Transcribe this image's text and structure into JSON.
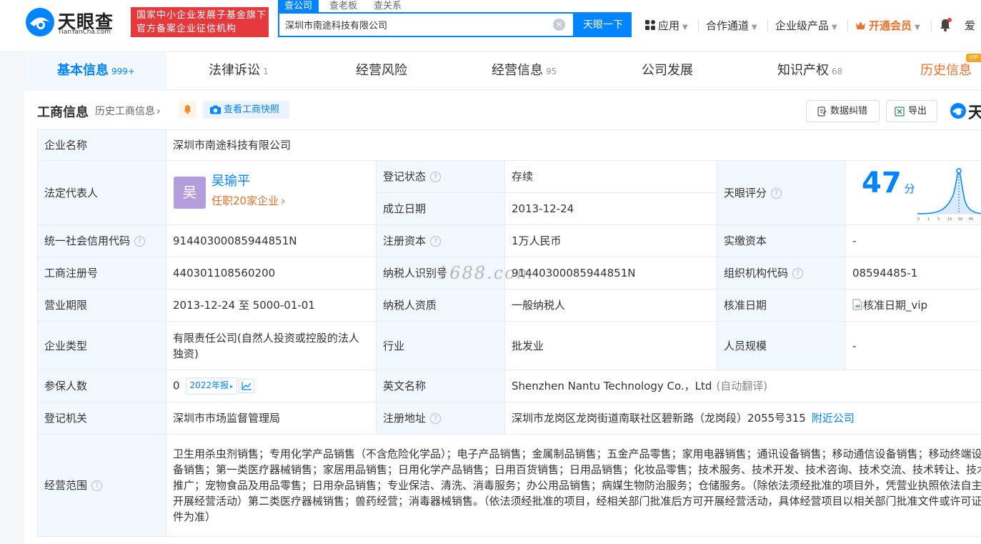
{
  "header": {
    "logo_cn": "天眼查",
    "logo_en": "TianYanCha.com",
    "banner_line1": "国家中小企业发展子基金旗下",
    "banner_line2": "官方备案企业征信机构",
    "search_tabs": [
      "查公司",
      "查老板",
      "查关系"
    ],
    "search_value": "深圳市南途科技有限公司",
    "search_button": "天眼一下",
    "nav": {
      "apps": "应用",
      "cooperation": "合作通道",
      "enterprise": "企业级产品",
      "vip": "开通会员",
      "user": "爱"
    }
  },
  "tabs": [
    {
      "label": "基本信息",
      "count": "999+"
    },
    {
      "label": "法律诉讼",
      "count": "1"
    },
    {
      "label": "经营风险",
      "count": ""
    },
    {
      "label": "经营信息",
      "count": "95"
    },
    {
      "label": "公司发展",
      "count": ""
    },
    {
      "label": "知识产权",
      "count": "68"
    },
    {
      "label": "历史信息",
      "count": ""
    }
  ],
  "vip_badge": "VIP",
  "section": {
    "title": "工商信息",
    "history_link": "历史工商信息",
    "snapshot_button": "查看工商快照",
    "correct_button": "数据纠错",
    "export_button": "导出",
    "brand_right": "天"
  },
  "info": {
    "company_name_label": "企业名称",
    "company_name": "深圳市南途科技有限公司",
    "legal_rep_label": "法定代表人",
    "legal_rep_avatar": "吴",
    "legal_rep_name": "吴瑜平",
    "legal_rep_sub": "任职20家企业",
    "reg_status_label": "登记状态",
    "reg_status": "存续",
    "established_label": "成立日期",
    "established": "2013-12-24",
    "score_label": "天眼评分",
    "score": "47",
    "score_unit": "分",
    "score_ticks": [
      "0",
      "1",
      "5",
      "15",
      "50",
      "85",
      "1"
    ],
    "credit_code_label": "统一社会信用代码",
    "credit_code": "91440300085944851N",
    "reg_capital_label": "注册资本",
    "reg_capital": "1万人民币",
    "paid_capital_label": "实缴资本",
    "paid_capital": "-",
    "reg_no_label": "工商注册号",
    "reg_no": "440301108560200",
    "taxpayer_id_label": "纳税人识别号",
    "taxpayer_id": "91440300085944851N",
    "org_code_label": "组织机构代码",
    "org_code": "08594485-1",
    "term_label": "营业期限",
    "term": "2013-12-24 至 5000-01-01",
    "taxpayer_type_label": "纳税人资质",
    "taxpayer_type": "一般纳税人",
    "approval_date_label": "核准日期",
    "approval_date_alt": "核准日期_vip",
    "company_type_label": "企业类型",
    "company_type": "有限责任公司(自然人投资或控股的法人独资)",
    "industry_label": "行业",
    "industry": "批发业",
    "staff_size_label": "人员规模",
    "staff_size": "-",
    "insured_label": "参保人数",
    "insured": "0",
    "insured_report": "2022年报",
    "english_name_label": "英文名称",
    "english_name": "Shenzhen Nantu Technology Co.，Ltd",
    "english_name_note": "(自动翻译)",
    "authority_label": "登记机关",
    "authority": "深圳市市场监督管理局",
    "address_label": "注册地址",
    "address": "深圳市龙岗区龙岗街道南联社区碧新路（龙岗段）2055号315",
    "nearby_link": "附近公司",
    "scope_label": "经营范围",
    "scope": "卫生用杀虫剂销售；专用化学产品销售（不含危险化学品）；电子产品销售；金属制品销售；五金产品零售；家用电器销售；通讯设备销售；移动通信设备销售；移动终端设备销售；第一类医疗器械销售；家居用品销售；日用化学产品销售；日用百货销售；日用品销售；化妆品零售；技术服务、技术开发、技术咨询、技术交流、技术转让、技术推广；宠物食品及用品零售；日用杂品销售；专业保洁、清洗、消毒服务；办公用品销售；病媒生物防治服务；仓储服务。（除依法须经批准的项目外，凭营业执照依法自主开展经营活动）第二类医疗器械销售；兽药经营；消毒器械销售。（依法须经批准的项目，经相关部门批准后方可开展经营活动，具体经营项目以相关部门批准文件或许可证件为准）"
  },
  "watermark": "1688.com"
}
